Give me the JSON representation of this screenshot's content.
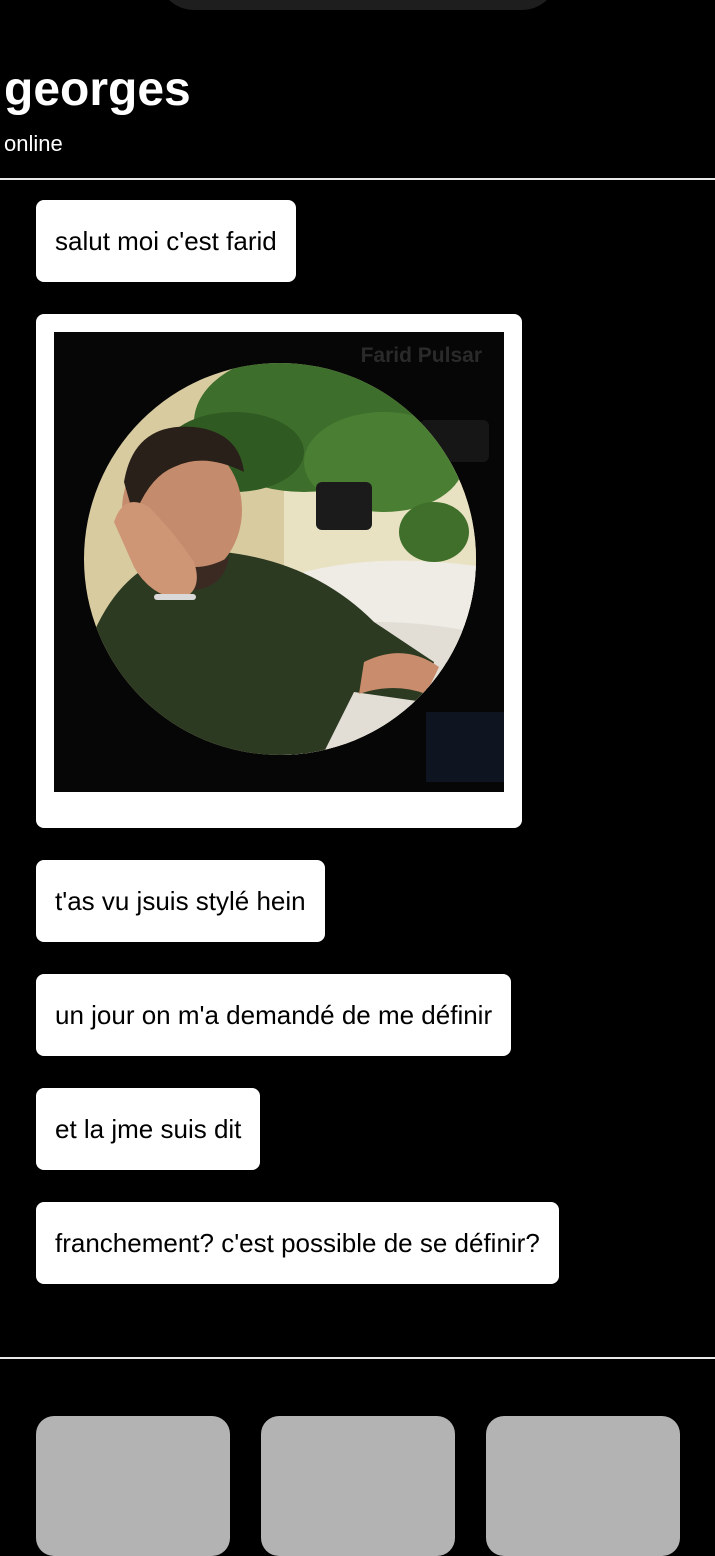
{
  "header": {
    "contact_name": "georges",
    "status": "online"
  },
  "photo_message": {
    "overlay_text": "Farid Pulsar"
  },
  "messages": [
    "salut moi c'est farid",
    "t'as vu jsuis stylé hein",
    "un jour on m'a demandé de me définir",
    "et la jme suis dit",
    "franchement? c'est possible de se définir?"
  ],
  "actions": [
    {
      "label": ""
    },
    {
      "label": ""
    },
    {
      "label": ""
    }
  ],
  "colors": {
    "background": "#000000",
    "bubble": "#ffffff",
    "bubble_text": "#000000",
    "action_button": "#b3b3b3",
    "divider": "#e8e8e8"
  }
}
